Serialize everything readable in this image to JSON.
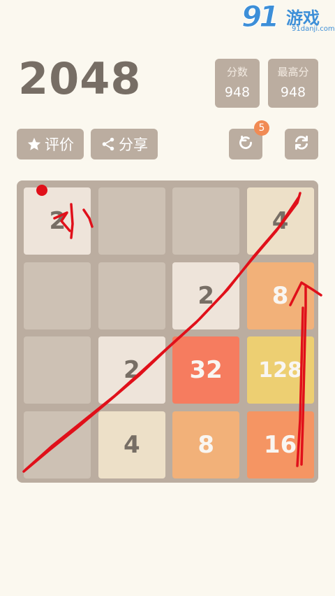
{
  "logo": {
    "mark": "91",
    "name": "游戏",
    "url": "91danji.com"
  },
  "title": "2048",
  "score": {
    "label": "分数",
    "value": "948"
  },
  "best": {
    "label": "最高分",
    "value": "948"
  },
  "buttons": {
    "rate_label": "评价",
    "share_label": "分享",
    "undo_badge": "5"
  },
  "board": {
    "cells": [
      [
        "2",
        "",
        "",
        "4"
      ],
      [
        "",
        "",
        "2",
        "8"
      ],
      [
        "",
        "2",
        "32",
        "128"
      ],
      [
        "",
        "4",
        "8",
        "16"
      ]
    ]
  },
  "annotation": {
    "color": "#e0101a"
  },
  "colors": {
    "background": "#fbf8ef",
    "board": "#bbada0",
    "empty_cell": "#cdc1b4",
    "tile_2": "#eee4da",
    "tile_4": "#ede0c8",
    "tile_8": "#f2b179",
    "tile_16": "#f59563",
    "tile_32": "#f67c5f",
    "tile_128": "#edcf72"
  }
}
